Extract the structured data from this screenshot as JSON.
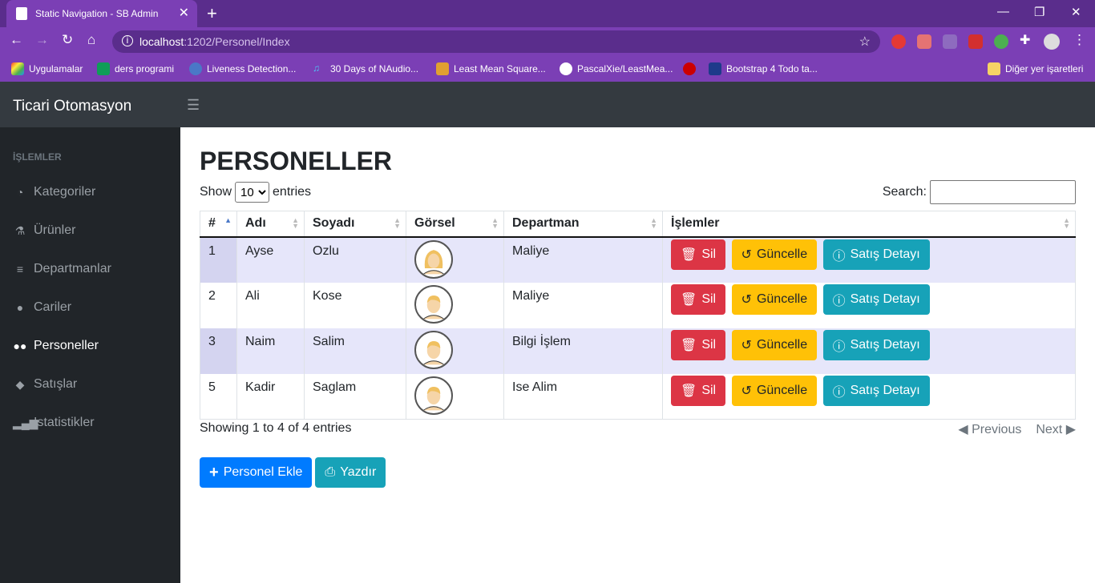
{
  "browser": {
    "tab_title": "Static Navigation - SB Admin",
    "url_host": "localhost",
    "url_path": ":1202/Personel/Index",
    "bookmarks": [
      "Uygulamalar",
      "ders programi",
      "Liveness Detection...",
      "30 Days of NAudio...",
      "Least Mean Square...",
      "PascalXie/LeastMea...",
      "",
      "Bootstrap 4 Todo ta..."
    ],
    "other_bookmarks": "Diğer yer işaretleri"
  },
  "app": {
    "brand": "Ticari Otomasyon",
    "toggle_icon": "hamburger-icon"
  },
  "sidebar": {
    "heading": "İŞLEMLER",
    "items": [
      {
        "label": "Kategoriler",
        "icon": "tachometer-icon"
      },
      {
        "label": "Ürünler",
        "icon": "flask-icon"
      },
      {
        "label": "Departmanlar",
        "icon": "list-icon"
      },
      {
        "label": "Cariler",
        "icon": "user-icon"
      },
      {
        "label": "Personeller",
        "icon": "users-icon",
        "active": true
      },
      {
        "label": "Satışlar",
        "icon": "tags-icon"
      },
      {
        "label": "Istatistikler",
        "icon": "signal-icon"
      }
    ]
  },
  "main": {
    "title": "PERSONELLER",
    "length": {
      "show": "Show",
      "value": "10",
      "entries": "entries"
    },
    "search": {
      "label": "Search:",
      "value": ""
    },
    "columns": [
      "#",
      "Adı",
      "Soyadı",
      "Görsel",
      "Departman",
      "İşlemler"
    ],
    "rows": [
      {
        "id": "1",
        "first": "Ayse",
        "last": "Ozlu",
        "dept": "Maliye",
        "avatar": "female-avatar-icon"
      },
      {
        "id": "2",
        "first": "Ali",
        "last": "Kose",
        "dept": "Maliye",
        "avatar": "male-avatar-icon"
      },
      {
        "id": "3",
        "first": "Naim",
        "last": "Salim",
        "dept": "Bilgi İşlem",
        "avatar": "male-avatar-icon"
      },
      {
        "id": "5",
        "first": "Kadir",
        "last": "Saglam",
        "dept": "Ise Alim",
        "avatar": "male-avatar-icon"
      }
    ],
    "row_buttons": {
      "delete": "Sil",
      "update": "Güncelle",
      "details": "Satış Detayı"
    },
    "info": "Showing 1 to 4 of 4 entries",
    "pager": {
      "previous": "Previous",
      "next": "Next"
    },
    "add_button": "Personel Ekle",
    "print_button": "Yazdır"
  },
  "colors": {
    "danger": "#dc3545",
    "warning": "#ffc107",
    "info": "#17a2b8",
    "primary": "#007bff",
    "browser": "#7b3fb5"
  }
}
